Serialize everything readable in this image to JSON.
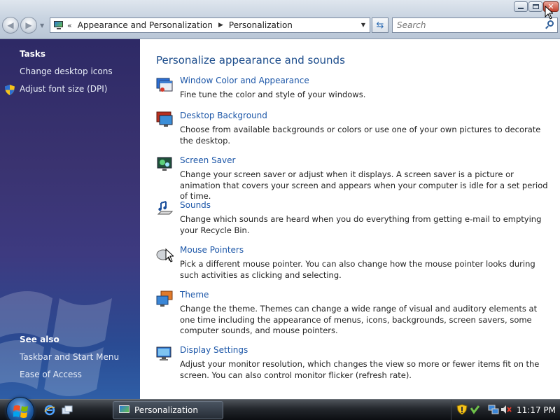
{
  "window": {
    "address_segments": [
      "Appearance and Personalization",
      "Personalization"
    ],
    "search_placeholder": "Search"
  },
  "sidebar": {
    "tasks_heading": "Tasks",
    "tasks": [
      {
        "label": "Change desktop icons",
        "icon": null
      },
      {
        "label": "Adjust font size (DPI)",
        "icon": "uac-shield-icon"
      }
    ],
    "see_also_heading": "See also",
    "see_also": [
      {
        "label": "Taskbar and Start Menu"
      },
      {
        "label": "Ease of Access"
      }
    ]
  },
  "main": {
    "title": "Personalize appearance and sounds",
    "items": [
      {
        "icon": "window-color-icon",
        "title": "Window Color and Appearance",
        "description": "Fine tune the color and style of your windows."
      },
      {
        "icon": "desktop-background-icon",
        "title": "Desktop Background",
        "description": "Choose from available backgrounds or colors or use one of your own pictures to decorate the desktop."
      },
      {
        "icon": "screen-saver-icon",
        "title": "Screen Saver",
        "description": "Change your screen saver or adjust when it displays. A screen saver is a picture or animation that covers your screen and appears when your computer is idle for a set period of time."
      },
      {
        "icon": "sounds-icon",
        "title": "Sounds",
        "description": "Change which sounds are heard when you do everything from getting e-mail to emptying your Recycle Bin."
      },
      {
        "icon": "mouse-pointers-icon",
        "title": "Mouse Pointers",
        "description": "Pick a different mouse pointer. You can also change how the mouse pointer looks during such activities as clicking and selecting."
      },
      {
        "icon": "theme-icon",
        "title": "Theme",
        "description": "Change the theme. Themes can change a wide range of visual and auditory elements at one time including the appearance of menus, icons, backgrounds, screen savers, some computer sounds, and mouse pointers."
      },
      {
        "icon": "display-settings-icon",
        "title": "Display Settings",
        "description": "Adjust your monitor resolution, which changes the view so more or fewer items fit on the screen. You can also control monitor flicker (refresh rate)."
      }
    ]
  },
  "taskbar": {
    "active_window": "Personalization",
    "clock": "11:17 PM"
  },
  "colors": {
    "link": "#1d57a8",
    "title": "#1d4d8c",
    "sidebar_top": "#2e2a66",
    "sidebar_bottom": "#2f5ea6"
  }
}
